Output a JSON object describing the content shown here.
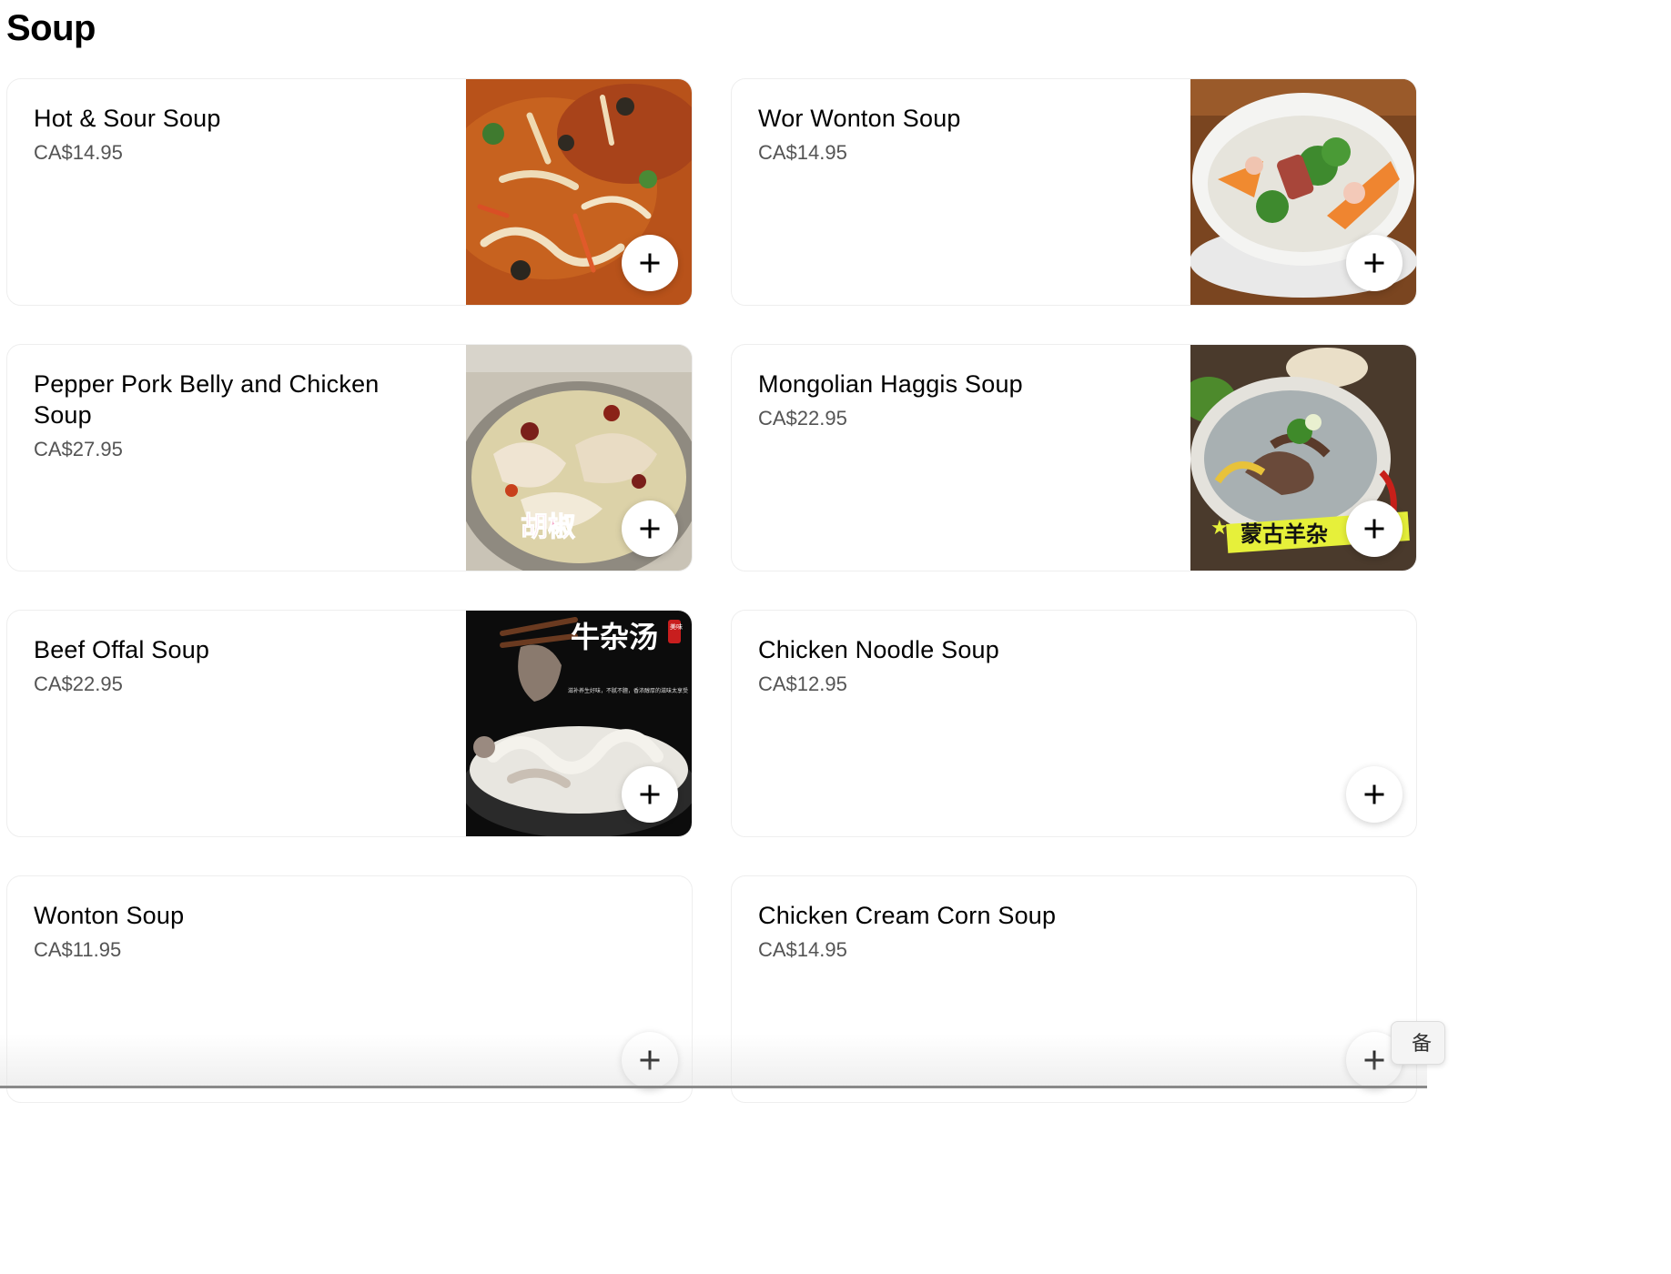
{
  "section": {
    "title": "Soup"
  },
  "items": [
    {
      "name": "Hot & Sour Soup",
      "price": "CA$14.95",
      "image": "hot-sour-soup-photo",
      "add_icon": "plus-icon"
    },
    {
      "name": "Wor Wonton Soup",
      "price": "CA$14.95",
      "image": "wor-wonton-soup-photo",
      "add_icon": "plus-icon"
    },
    {
      "name": "Pepper Pork Belly and Chicken Soup",
      "price": "CA$27.95",
      "image": "pepper-pork-belly-soup-photo",
      "add_icon": "plus-icon"
    },
    {
      "name": "Mongolian Haggis Soup",
      "price": "CA$22.95",
      "image": "mongolian-haggis-soup-photo",
      "add_icon": "plus-icon"
    },
    {
      "name": "Beef Offal Soup",
      "price": "CA$22.95",
      "image": "beef-offal-soup-photo",
      "add_icon": "plus-icon"
    },
    {
      "name": "Chicken Noodle Soup",
      "price": "CA$12.95",
      "add_icon": "plus-icon"
    },
    {
      "name": "Wonton Soup",
      "price": "CA$11.95",
      "add_icon": "plus-icon"
    },
    {
      "name": "Chicken Cream Corn Soup",
      "price": "CA$14.95",
      "add_icon": "plus-icon"
    }
  ],
  "image_captions": {
    "pepper_pork": "胡椒",
    "haggis": "蒙古羊杂",
    "offal_title": "牛杂汤",
    "offal_seal": "美味",
    "offal_sub": "滋补养生好味，不腻不膻，香浓醇厚的滋味太享受"
  },
  "floating_widget": {
    "label": "备"
  },
  "colors": {
    "price": "#545454",
    "card_border": "#eeeeee",
    "button_bg": "#ffffff"
  }
}
